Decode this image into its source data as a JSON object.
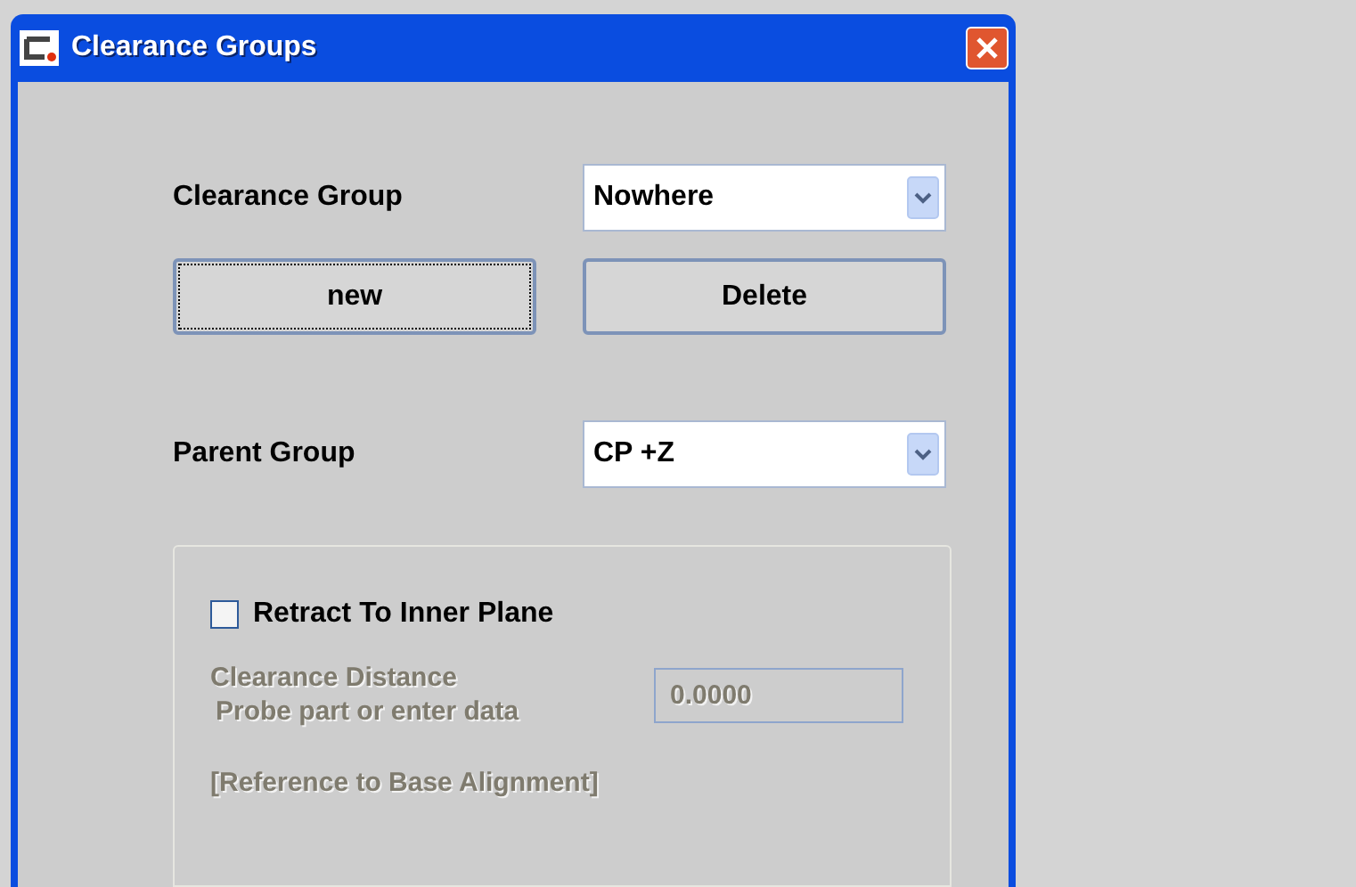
{
  "window": {
    "title": "Clearance Groups"
  },
  "clearance_group": {
    "label": "Clearance Group",
    "value": "Nowhere"
  },
  "buttons": [
    {
      "label": "new",
      "focused": true
    },
    {
      "label": "Delete",
      "focused": false
    }
  ],
  "parent_group": {
    "label": "Parent Group",
    "value": "CP +Z"
  },
  "retract": {
    "label": "Retract To Inner Plane",
    "checked": false
  },
  "clearance_distance": {
    "label_lines": [
      "Clearance Distance",
      "Probe part or enter data"
    ],
    "value": "0.0000",
    "disabled": true
  },
  "reference_note": {
    "text": "[Reference to Base Alignment]",
    "disabled": true
  }
}
